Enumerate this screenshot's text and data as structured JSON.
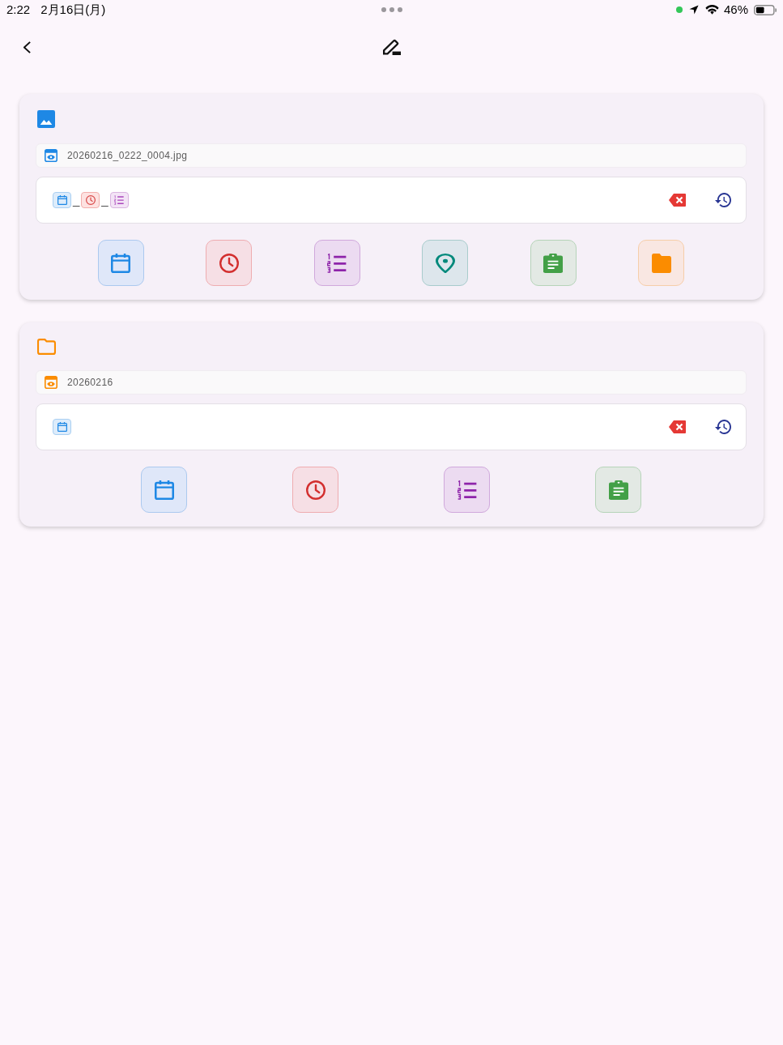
{
  "status_bar": {
    "time": "2:22",
    "date": "2月16日(月)",
    "battery": "46%"
  },
  "cards": [
    {
      "kind": "image",
      "preview": "20260216_0222_0004.jpg",
      "pattern": [
        {
          "kind": "date"
        },
        {
          "kind": "text",
          "text": "_"
        },
        {
          "kind": "time"
        },
        {
          "kind": "text",
          "text": "_"
        },
        {
          "kind": "counter"
        }
      ],
      "buttons": [
        {
          "kind": "date"
        },
        {
          "kind": "time"
        },
        {
          "kind": "counter"
        },
        {
          "kind": "location"
        },
        {
          "kind": "clipboard"
        },
        {
          "kind": "folder"
        }
      ]
    },
    {
      "kind": "folder",
      "preview": "20260216",
      "pattern": [
        {
          "kind": "date"
        }
      ],
      "buttons": [
        {
          "kind": "date"
        },
        {
          "kind": "time"
        },
        {
          "kind": "counter"
        },
        {
          "kind": "clipboard"
        }
      ]
    }
  ]
}
